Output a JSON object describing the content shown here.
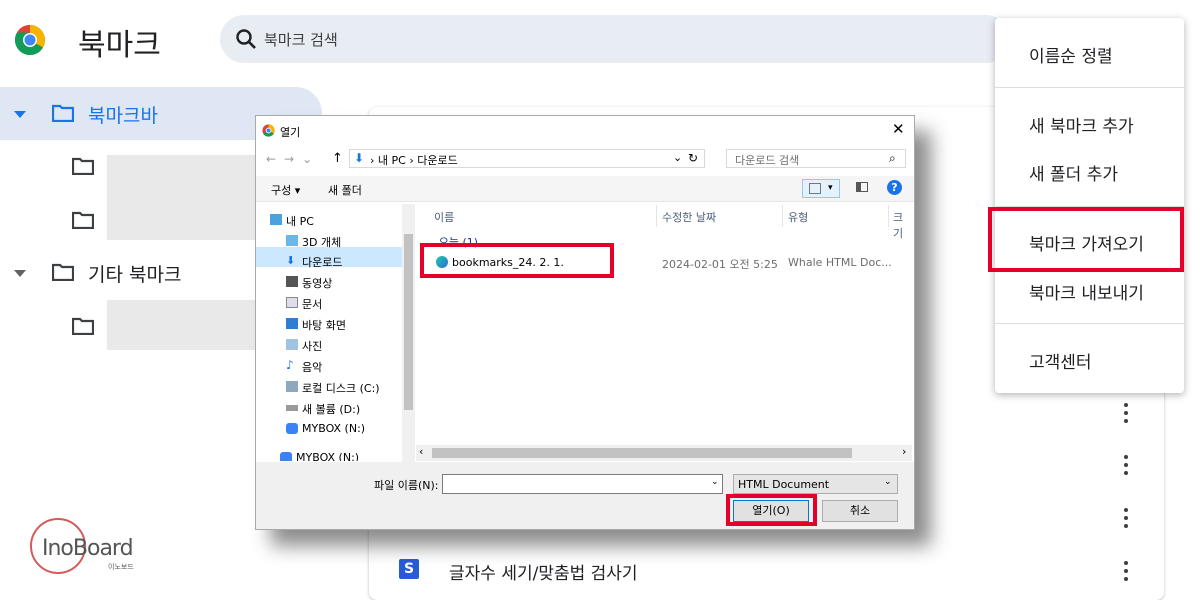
{
  "app": {
    "title": "북마크"
  },
  "search": {
    "placeholder": "북마크 검색"
  },
  "tree": {
    "root": "북마크바",
    "other": "기타 북마크"
  },
  "menu": {
    "items": [
      "이름순 정렬",
      "새 북마크 추가",
      "새 폴더 추가",
      "북마크 가져오기",
      "북마크 내보내기",
      "고객센터"
    ]
  },
  "list": {
    "bottom_item": "글자수 세기/맞춤법 검사기",
    "bottom_badge": "S"
  },
  "dialog": {
    "title": "열기",
    "path": [
      "내 PC",
      "다운로드"
    ],
    "search_placeholder": "다운로드 검색",
    "organize": "구성 ▾",
    "new_folder": "새 폴더",
    "sidebar": [
      "내 PC",
      "3D 개체",
      "다운로드",
      "동영상",
      "문서",
      "바탕 화면",
      "사진",
      "음악",
      "로컬 디스크 (C:)",
      "새 볼륨 (D:)",
      "MYBOX (N:)",
      "MYBOX (N:)"
    ],
    "columns": [
      "이름",
      "수정한 날짜",
      "유형",
      "크기"
    ],
    "group": "오늘 (1)",
    "file": {
      "name": "bookmarks_24. 2. 1.",
      "date": "2024-02-01 오전 5:25",
      "type": "Whale HTML Doc..."
    },
    "filename_label": "파일 이름(N):",
    "filetype": "HTML Document",
    "open_button": "열기(O)",
    "cancel_button": "취소"
  },
  "watermark": {
    "brand": "InoBoard",
    "sub": "이노보드"
  },
  "colors": {
    "accent": "#1a73e8",
    "highlight": "#e4002b",
    "selected_bg": "#dfe6f4"
  }
}
